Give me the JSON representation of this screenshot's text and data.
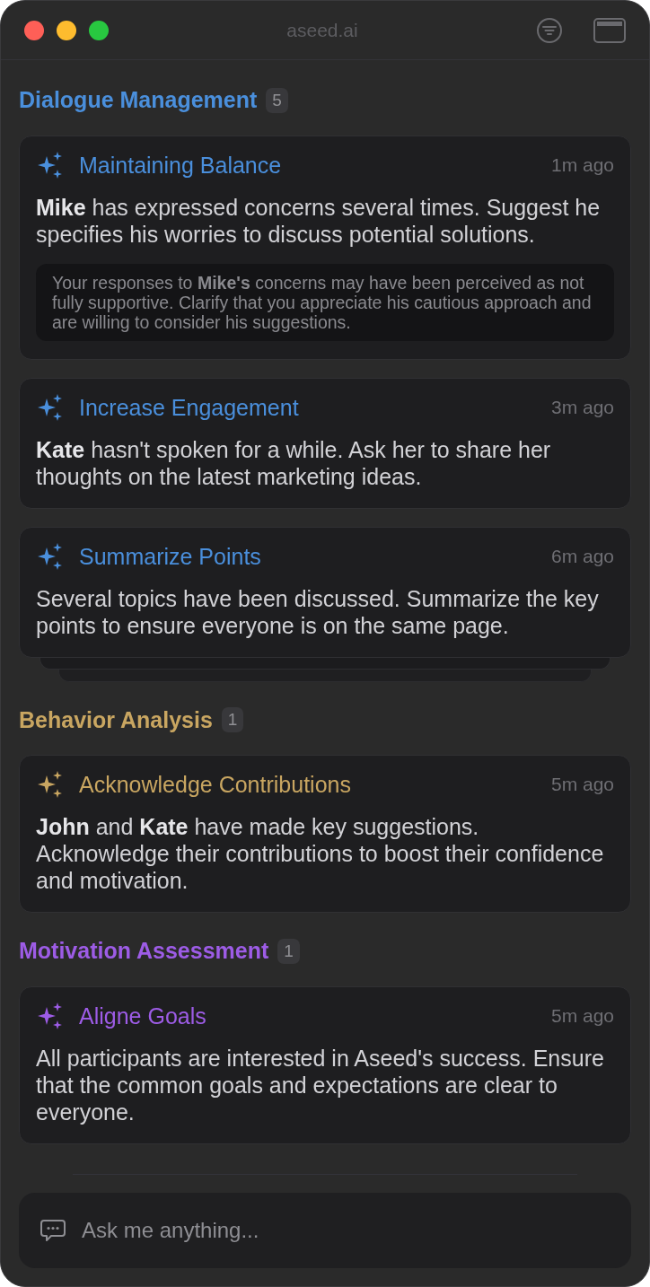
{
  "window": {
    "title": "aseed.ai"
  },
  "sections": [
    {
      "title": "Dialogue Management",
      "count": "5",
      "color": "#4a8fdc",
      "stacked": true,
      "cards": [
        {
          "title": "Maintaining Balance",
          "time": "1m ago",
          "body": "**Mike** has expressed concerns several times. Suggest he specifies his worries to discuss potential solutions.",
          "note": "Your responses to **Mike's** concerns may have been perceived as not fully supportive. Clarify that you appreciate his cautious approach and are willing to consider his suggestions."
        },
        {
          "title": "Increase Engagement",
          "time": "3m ago",
          "body": "**Kate** hasn't spoken for a while. Ask her to share her thoughts on the latest marketing ideas."
        },
        {
          "title": "Summarize Points",
          "time": "6m ago",
          "body": "Several topics have been discussed. Summarize the key points to ensure everyone is on the same page."
        }
      ]
    },
    {
      "title": "Behavior Analysis",
      "count": "1",
      "color": "#c9a661",
      "stacked": false,
      "cards": [
        {
          "title": "Acknowledge Contributions",
          "time": "5m ago",
          "body": "**John** and **Kate** have made key suggestions. Acknowledge their contributions to boost their confidence and motivation."
        }
      ]
    },
    {
      "title": "Motivation Assessment",
      "count": "1",
      "color": "#9d5ce6",
      "stacked": false,
      "cards": [
        {
          "title": "Aligne Goals",
          "time": "5m ago",
          "body": "All participants are interested in Aseed's success. Ensure that the common goals and expectations are clear to everyone."
        }
      ]
    }
  ],
  "input": {
    "placeholder": "Ask me anything..."
  }
}
